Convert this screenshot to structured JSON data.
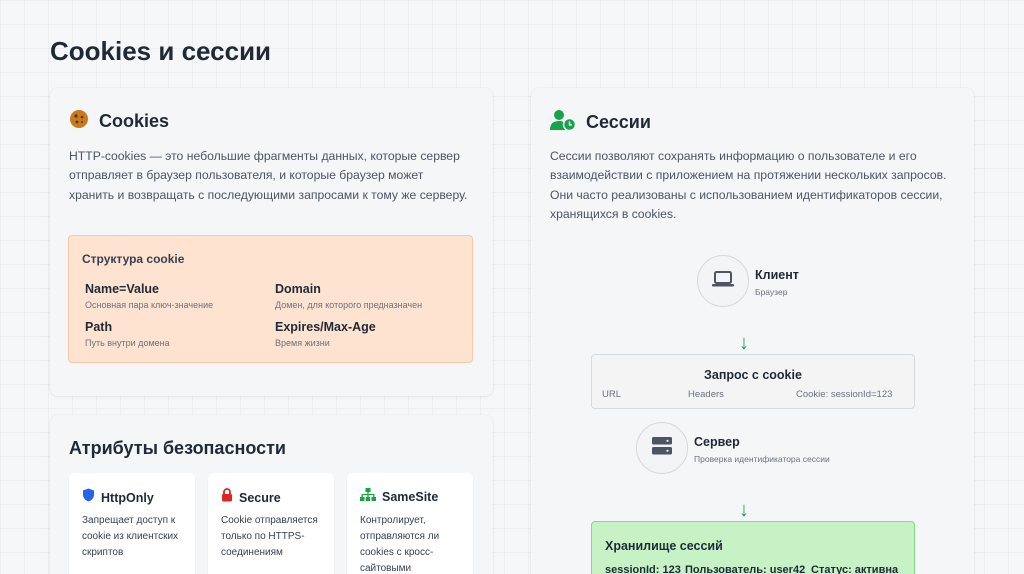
{
  "page_title": "Cookies и сессии",
  "cookies": {
    "title": "Cookies",
    "icon": "cookie-icon",
    "description": "HTTP-cookies — это небольшие фрагменты данных, которые сервер отправляет в браузер пользователя, и которые браузер может хранить и возвращать с последующими запросами к тому же серверу.",
    "structure": {
      "title": "Структура cookie",
      "fields": [
        {
          "name": "Name=Value",
          "desc": "Основная пара ключ-значение"
        },
        {
          "name": "Domain",
          "desc": "Домен, для которого предназначен"
        },
        {
          "name": "Path",
          "desc": "Путь внутри домена"
        },
        {
          "name": "Expires/Max-Age",
          "desc": "Время жизни"
        }
      ]
    }
  },
  "security": {
    "title": "Атрибуты безопасности",
    "attributes": [
      {
        "name": "HttpOnly",
        "icon": "shield-icon",
        "desc": "Запрещает доступ к cookie из клиентских скриптов"
      },
      {
        "name": "Secure",
        "icon": "lock-icon",
        "desc": "Cookie отправляется только по HTTPS-соединениям"
      },
      {
        "name": "SameSite",
        "icon": "sitemap-icon",
        "desc": "Контролирует, отправляются ли cookies с кросс-сайтовыми"
      }
    ]
  },
  "sessions": {
    "title": "Сессии",
    "icon": "user-clock-icon",
    "description": "Сессии позволяют сохранять информацию о пользователе и его взаимодействии с приложением на протяжении нескольких запросов. Они часто реализованы с использованием идентификаторов сессии, хранящихся в cookies.",
    "client": {
      "title": "Клиент",
      "subtitle": "Браузер",
      "icon": "laptop-icon"
    },
    "request": {
      "title": "Запрос с cookie",
      "fields": [
        "URL",
        "Headers",
        "Cookie: sessionId=123"
      ]
    },
    "server": {
      "title": "Сервер",
      "subtitle": "Проверка идентификатора сессии",
      "icon": "server-icon"
    },
    "storage": {
      "title": "Хранилище сессий",
      "fields": [
        "sessionId: 123",
        "Пользователь: user42",
        "Статус: активна"
      ]
    },
    "arrow_glyph": "↓"
  },
  "colors": {
    "cookie_accent": "#c97a1a",
    "session_accent": "#16a34a",
    "shield": "#2563eb",
    "lock": "#dc2626",
    "sitemap": "#16a34a",
    "structure_bg": "#fde3d0",
    "storage_bg": "#c6f2c6"
  }
}
